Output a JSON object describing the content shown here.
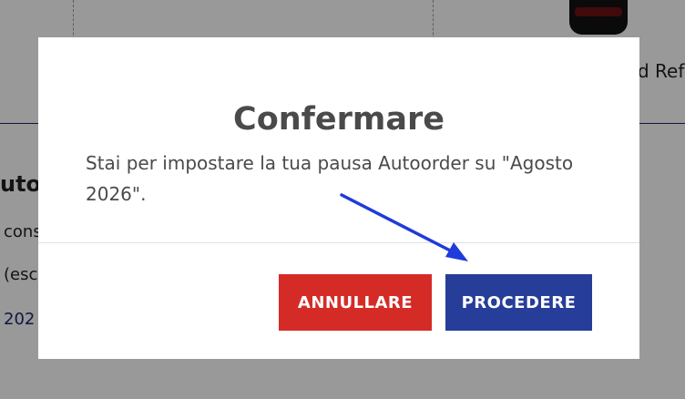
{
  "background": {
    "product_text": "d Ref",
    "left_title": "utor",
    "left_lines": [
      "cons",
      "(esclu",
      "202"
    ]
  },
  "modal": {
    "title": "Confermare",
    "message": "Stai per impostare la tua pausa Autoorder su \"Agosto 2026\".",
    "cancel_label": "ANNULLARE",
    "proceed_label": "PROCEDERE"
  },
  "colors": {
    "cancel": "#d52b27",
    "proceed": "#263d99",
    "annotation_arrow": "#1f3bd9"
  },
  "icons": {
    "annotation": "arrow-icon"
  }
}
